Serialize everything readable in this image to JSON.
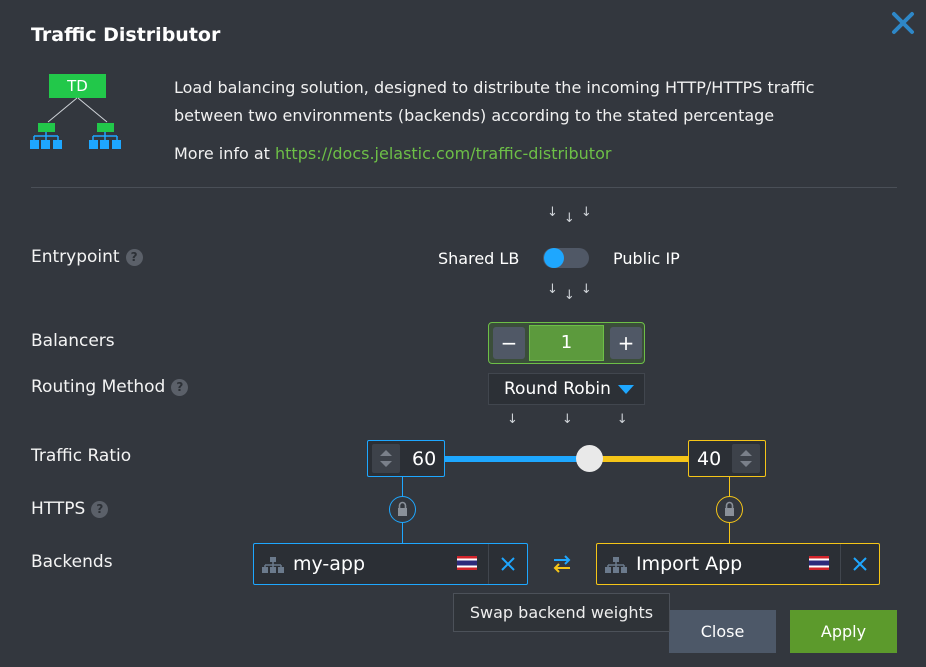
{
  "dialog": {
    "title": "Traffic Distributor",
    "logo_text": "TD",
    "description": "Load balancing solution, designed to distribute the incoming HTTP/HTTPS traffic between two environments (backends) according to the stated percentage",
    "more_info_prefix": "More info at ",
    "more_info_link": "https://docs.jelastic.com/traffic-distributor"
  },
  "form": {
    "entrypoint": {
      "label": "Entrypoint",
      "left_option": "Shared LB",
      "right_option": "Public IP"
    },
    "balancers": {
      "label": "Balancers",
      "value": "1",
      "minus": "−",
      "plus": "+"
    },
    "routing": {
      "label": "Routing Method",
      "value": "Round Robin"
    },
    "traffic_ratio": {
      "label": "Traffic Ratio",
      "left": "60",
      "right": "40"
    },
    "https": {
      "label": "HTTPS"
    },
    "backends": {
      "label": "Backends",
      "left_name": "my-app",
      "right_name": "Import App"
    }
  },
  "help_glyph": "?",
  "tooltip": "Swap backend weights",
  "buttons": {
    "close": "Close",
    "apply": "Apply"
  },
  "colors": {
    "blue": "#1ea7ff",
    "yellow": "#f5c518",
    "green": "#6dbf47",
    "apply": "#5c9a2c"
  },
  "icons": [
    "close-icon",
    "help-icon",
    "lock-icon",
    "swap-icon",
    "remove-icon",
    "environment-icon",
    "flag-icon",
    "caret-down-icon",
    "arrow-down-icon"
  ]
}
